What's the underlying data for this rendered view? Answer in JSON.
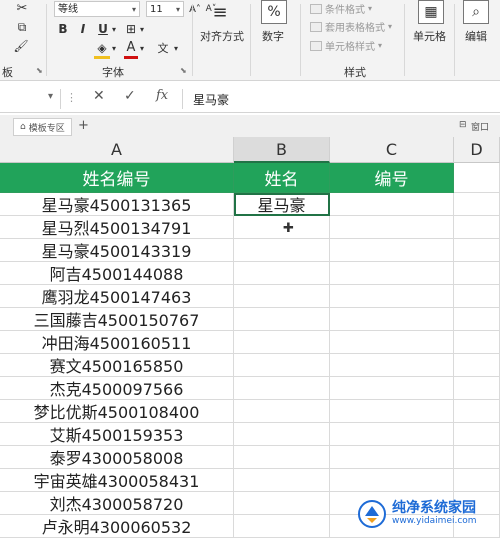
{
  "ribbon": {
    "font_name": "等线",
    "font_size": "11",
    "bold": "B",
    "italic": "I",
    "underline": "U",
    "font_color_letter": "A",
    "wen": "文",
    "group_clipboard": "板",
    "group_font": "字体",
    "group_style": "样式",
    "align_label": "对齐方式",
    "number_label": "数字",
    "conditional_format": "条件格式",
    "table_format": "套用表格格式",
    "cell_style": "单元格样式",
    "cells_label": "单元格",
    "edit_label": "编辑",
    "percent_symbol": "%"
  },
  "formula_bar": {
    "cancel": "✕",
    "confirm": "✓",
    "fx": "fx",
    "value": "星马豪"
  },
  "tabs": {
    "template_zone": "模板专区",
    "add": "+",
    "right_label": "窗口"
  },
  "columns": [
    "A",
    "B",
    "C",
    "D"
  ],
  "header_row": {
    "a": "姓名编号",
    "b": "姓名",
    "c": "编号"
  },
  "active_cell": {
    "b2": "星马豪"
  },
  "rows": [
    "星马豪4500131365",
    "星马烈4500134791",
    "星马豪4500143319",
    "阿吉4500144088",
    "鹰羽龙4500147463",
    "三国藤吉4500150767",
    "冲田海4500160511",
    "赛文4500165850",
    "杰克4500097566",
    "梦比优斯4500108400",
    "艾斯4500159353",
    "泰罗4300058008",
    "宇宙英雄4300058431",
    "刘杰4300058720",
    "卢永明4300060532"
  ],
  "watermark": {
    "title": "纯净系统家园",
    "url": "www.yidaimei.com",
    "brand_color": "#1e6bd6"
  },
  "colors": {
    "header_fill": "#21a35a",
    "selection": "#217346"
  }
}
